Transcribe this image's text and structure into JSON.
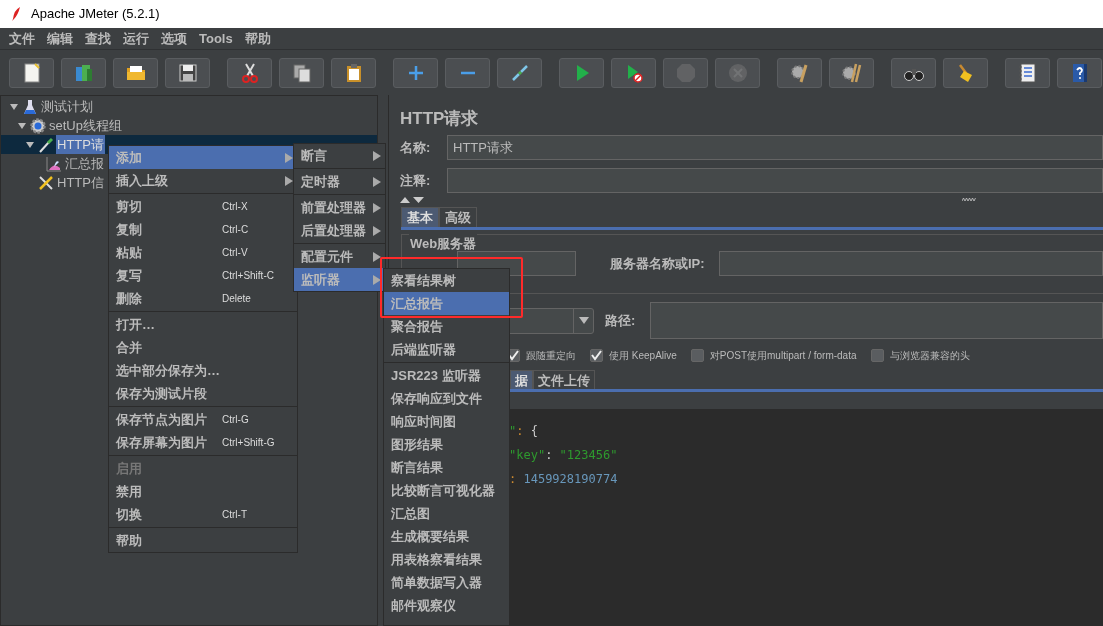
{
  "window": {
    "title": "Apache JMeter (5.2.1)"
  },
  "menu_bar": [
    "文件",
    "编辑",
    "查找",
    "运行",
    "选项",
    "Tools",
    "帮助"
  ],
  "toolbar": [
    [
      {
        "kind": "new",
        "disabled": false
      },
      {
        "kind": "templates",
        "disabled": false
      },
      {
        "kind": "open",
        "disabled": false
      },
      {
        "kind": "save",
        "disabled": false
      }
    ],
    [
      {
        "kind": "cut",
        "disabled": false
      },
      {
        "kind": "copy",
        "disabled": false
      },
      {
        "kind": "paste",
        "disabled": false
      }
    ],
    [
      {
        "kind": "expand",
        "disabled": false
      },
      {
        "kind": "collapse",
        "disabled": false
      },
      {
        "kind": "toggle",
        "disabled": false
      }
    ],
    [
      {
        "kind": "start",
        "disabled": false
      },
      {
        "kind": "start_no_pause",
        "disabled": false
      },
      {
        "kind": "stop",
        "disabled": true
      },
      {
        "kind": "shutdown",
        "disabled": true
      }
    ],
    [
      {
        "kind": "clear",
        "disabled": false
      },
      {
        "kind": "clear_all",
        "disabled": false
      }
    ],
    [
      {
        "kind": "search",
        "disabled": false
      },
      {
        "kind": "reset_search",
        "disabled": false
      }
    ],
    [
      {
        "kind": "functions",
        "disabled": false
      },
      {
        "kind": "help",
        "disabled": false
      }
    ]
  ],
  "tree": [
    {
      "label": "测试计划",
      "kind": "plan",
      "selected": false,
      "expanded": true,
      "children": [
        {
          "label": "setUp线程组",
          "kind": "thread_group",
          "selected": false,
          "expanded": true,
          "children": [
            {
              "label": "HTTP请",
              "kind": "sampler",
              "selected": true,
              "expanded": true,
              "children": [
                {
                  "label": "汇总报",
                  "kind": "listener",
                  "selected": false
                }
              ]
            },
            {
              "label": "HTTP信",
              "kind": "config",
              "selected": false
            }
          ]
        }
      ]
    }
  ],
  "context_menu": {
    "groups": [
      {
        "items": [
          {
            "label": "添加",
            "submenu": true,
            "selected": true,
            "disabled": false
          },
          {
            "label": "插入上级",
            "submenu": true,
            "selected": false,
            "disabled": false
          }
        ]
      },
      {
        "items": [
          {
            "label": "剪切",
            "shortcut": "Ctrl-X",
            "submenu": false,
            "selected": false,
            "disabled": false
          },
          {
            "label": "复制",
            "shortcut": "Ctrl-C",
            "submenu": false,
            "selected": false,
            "disabled": false
          },
          {
            "label": "粘贴",
            "shortcut": "Ctrl-V",
            "submenu": false,
            "selected": false,
            "disabled": false
          },
          {
            "label": "复写",
            "shortcut": "Ctrl+Shift-C",
            "submenu": false,
            "selected": false,
            "disabled": false
          },
          {
            "label": "删除",
            "shortcut": "Delete",
            "submenu": false,
            "selected": false,
            "disabled": false
          }
        ]
      },
      {
        "items": [
          {
            "label": "打开…",
            "submenu": false,
            "selected": false,
            "disabled": false
          },
          {
            "label": "合并",
            "submenu": false,
            "selected": false,
            "disabled": false
          },
          {
            "label": "选中部分保存为…",
            "submenu": false,
            "selected": false,
            "disabled": false
          },
          {
            "label": "保存为测试片段",
            "submenu": false,
            "selected": false,
            "disabled": false
          }
        ]
      },
      {
        "items": [
          {
            "label": "保存节点为图片",
            "shortcut": "Ctrl-G",
            "submenu": false,
            "selected": false,
            "disabled": false
          },
          {
            "label": "保存屏幕为图片",
            "shortcut": "Ctrl+Shift-G",
            "submenu": false,
            "selected": false,
            "disabled": false
          }
        ]
      },
      {
        "items": [
          {
            "label": "启用",
            "submenu": false,
            "selected": false,
            "disabled": true
          },
          {
            "label": "禁用",
            "submenu": false,
            "selected": false,
            "disabled": false
          },
          {
            "label": "切换",
            "shortcut": "Ctrl-T",
            "submenu": false,
            "selected": false,
            "disabled": false
          }
        ]
      },
      {
        "items": [
          {
            "label": "帮助",
            "submenu": false,
            "selected": false,
            "disabled": false
          }
        ]
      }
    ]
  },
  "add_submenu": {
    "groups": [
      {
        "items": [
          {
            "label": "断言",
            "submenu": true,
            "selected": false,
            "disabled": false
          }
        ]
      },
      {
        "items": [
          {
            "label": "定时器",
            "submenu": true,
            "selected": false,
            "disabled": false
          }
        ]
      },
      {
        "items": [
          {
            "label": "前置处理器",
            "submenu": true,
            "selected": false,
            "disabled": false
          },
          {
            "label": "后置处理器",
            "submenu": true,
            "selected": false,
            "disabled": false
          }
        ]
      },
      {
        "items": [
          {
            "label": "配置元件",
            "submenu": true,
            "selected": false,
            "disabled": false
          },
          {
            "label": "监听器",
            "submenu": true,
            "selected": true,
            "disabled": false
          }
        ]
      }
    ]
  },
  "listener_submenu": {
    "groups": [
      {
        "items": [
          {
            "label": "察看结果树",
            "submenu": false,
            "selected": false,
            "disabled": false
          },
          {
            "label": "汇总报告",
            "submenu": false,
            "selected": true,
            "disabled": false
          },
          {
            "label": "聚合报告",
            "submenu": false,
            "selected": false,
            "disabled": false
          },
          {
            "label": "后端监听器",
            "submenu": false,
            "selected": false,
            "disabled": false
          }
        ]
      },
      {
        "items": [
          {
            "label": "JSR223 监听器",
            "submenu": false,
            "selected": false,
            "disabled": false
          },
          {
            "label": "保存响应到文件",
            "submenu": false,
            "selected": false,
            "disabled": false
          },
          {
            "label": "响应时间图",
            "submenu": false,
            "selected": false,
            "disabled": false
          },
          {
            "label": "图形结果",
            "submenu": false,
            "selected": false,
            "disabled": false
          },
          {
            "label": "断言结果",
            "submenu": false,
            "selected": false,
            "disabled": false
          },
          {
            "label": "比较断言可视化器",
            "submenu": false,
            "selected": false,
            "disabled": false
          },
          {
            "label": "汇总图",
            "submenu": false,
            "selected": false,
            "disabled": false
          },
          {
            "label": "生成概要结果",
            "submenu": false,
            "selected": false,
            "disabled": false
          },
          {
            "label": "用表格察看结果",
            "submenu": false,
            "selected": false,
            "disabled": false
          },
          {
            "label": "简单数据写入器",
            "submenu": false,
            "selected": false,
            "disabled": false
          },
          {
            "label": "邮件观察仪",
            "submenu": false,
            "selected": false,
            "disabled": false
          }
        ]
      }
    ]
  },
  "editor_panel": {
    "title": "HTTP请求",
    "name_field": {
      "label": "名称:",
      "value": "HTTP请求"
    },
    "comment_field": {
      "label": "注释:"
    },
    "tabs": [
      {
        "label": "基本",
        "selected": true
      },
      {
        "label": "高级",
        "selected": false
      }
    ],
    "web_server": {
      "legend": "Web服务器",
      "server_label": "服务器名称或IP:"
    },
    "path_label": "路径:",
    "options": [
      {
        "label": "跟随重定向",
        "checked": true
      },
      {
        "label": "使用 KeepAlive",
        "checked": true
      },
      {
        "label": "对POST使用multipart / form-data",
        "checked": false
      },
      {
        "label": "与浏览器兼容的头",
        "checked": false
      }
    ],
    "body_tabs": [
      {
        "label": "据",
        "selected": true
      },
      {
        "label": "文件上传",
        "selected": false
      }
    ],
    "code_lines": [
      {
        "tokens": [
          {
            "kind": "string",
            "text": "\""
          },
          {
            "kind": "punct",
            "text": ":"
          },
          {
            "kind": "plain",
            "text": " {"
          }
        ]
      },
      {
        "tokens": [
          {
            "kind": "string",
            "text": "\"key\""
          },
          {
            "kind": "plain",
            "text": ": "
          },
          {
            "kind": "string",
            "text": "\"123456\""
          }
        ]
      },
      {
        "tokens": [
          {
            "kind": "punct",
            "text": ": "
          },
          {
            "kind": "number",
            "text": "1459928190774"
          }
        ]
      }
    ]
  }
}
